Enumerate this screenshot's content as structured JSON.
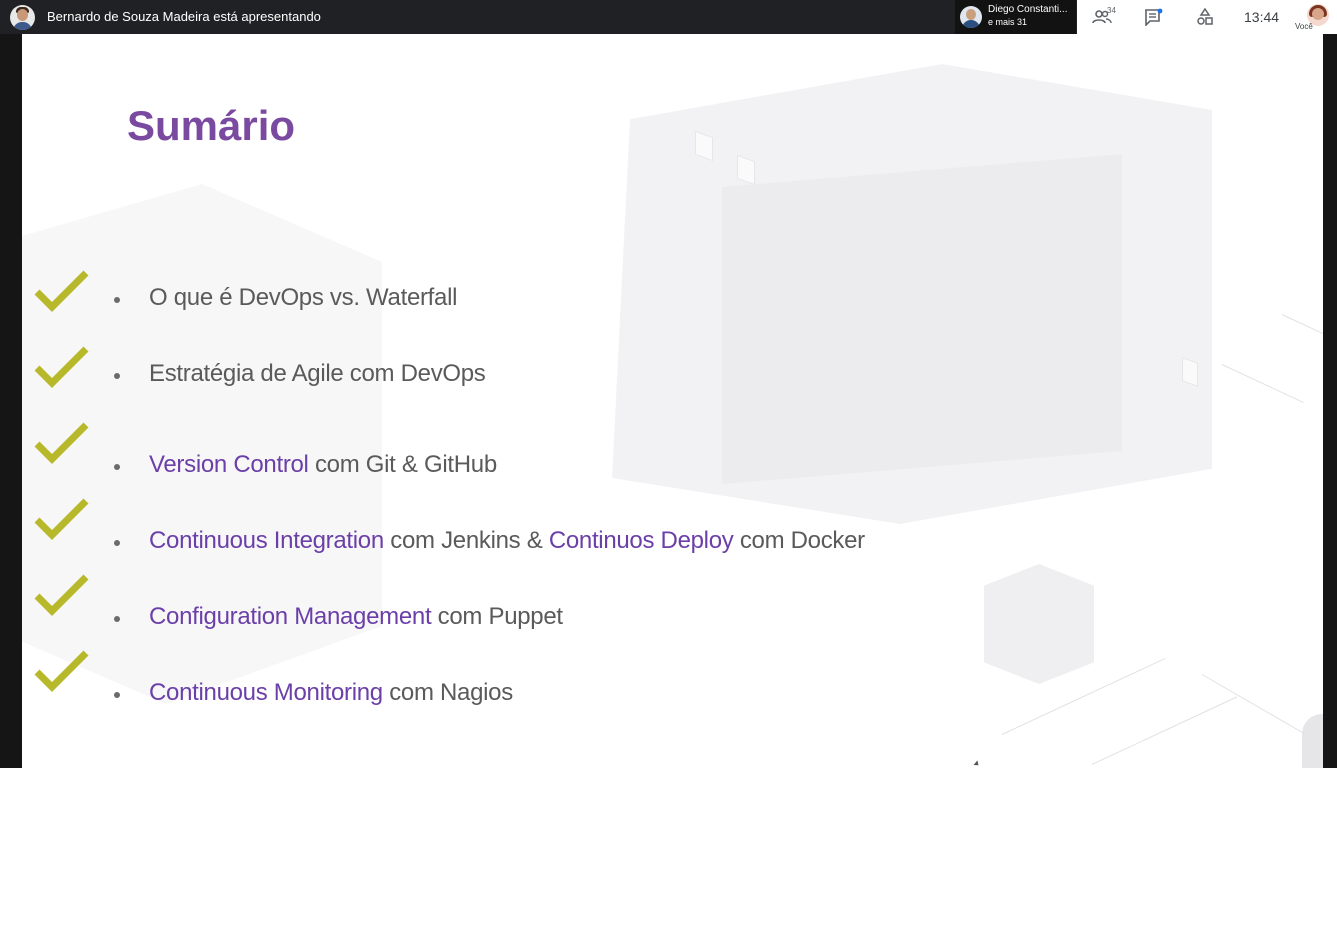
{
  "meet": {
    "presenter_text": "Bernardo de Souza Madeira está apresentando",
    "participant_name": "Diego Constanti...",
    "participant_more": "e mais 31",
    "participants_count": "34",
    "clock": "13:44",
    "self_label": "Você",
    "icons": [
      "people-icon",
      "chat-icon",
      "activities-icon"
    ]
  },
  "slide": {
    "title": "Sumário",
    "check_color": "#b7b92a",
    "title_color": "#7a4aa0",
    "highlight_color": "#6b3fa8",
    "items": [
      {
        "checked": true,
        "parts": [
          {
            "text": "O que é DevOps vs. Waterfall",
            "hl": false
          }
        ]
      },
      {
        "checked": true,
        "parts": [
          {
            "text": "Estratégia de Agile com DevOps",
            "hl": false
          }
        ]
      },
      {
        "checked": true,
        "parts": [
          {
            "text": "Version Control",
            "hl": true
          },
          {
            "text": " com Git & GitHub",
            "hl": false
          }
        ]
      },
      {
        "checked": true,
        "parts": [
          {
            "text": "Continuous Integration",
            "hl": true
          },
          {
            "text": " com Jenkins & ",
            "hl": false
          },
          {
            "text": "Continuos Deploy",
            "hl": true
          },
          {
            "text": " com Docker",
            "hl": false
          }
        ]
      },
      {
        "checked": true,
        "parts": [
          {
            "text": "Configuration Management",
            "hl": true
          },
          {
            "text": " com Puppet",
            "hl": false
          }
        ]
      },
      {
        "checked": true,
        "parts": [
          {
            "text": "Continuous Monitoring",
            "hl": true
          },
          {
            "text": " com Nagios",
            "hl": false
          }
        ]
      }
    ]
  }
}
